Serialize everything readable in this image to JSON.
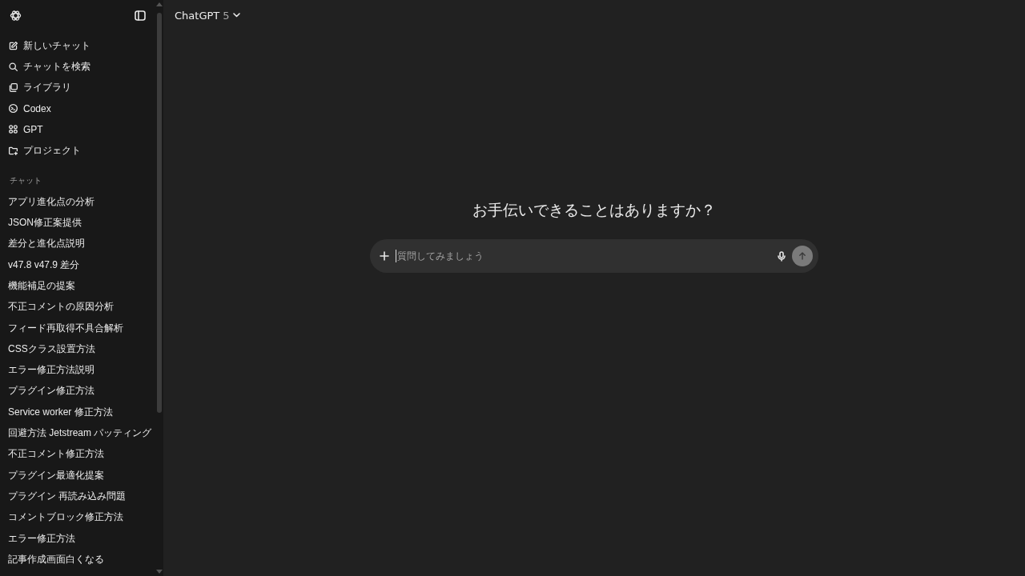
{
  "sidebar": {
    "nav_items": [
      {
        "kind": "new-chat",
        "label": "新しいチャット"
      },
      {
        "kind": "search",
        "label": "チャットを検索"
      },
      {
        "kind": "library",
        "label": "ライブラリ"
      },
      {
        "kind": "codex",
        "label": "Codex"
      },
      {
        "kind": "gpts",
        "label": "GPT"
      },
      {
        "kind": "project",
        "label": "プロジェクト"
      }
    ],
    "section_title": "チャット",
    "chats": [
      "アプリ進化点の分析",
      "JSON修正案提供",
      "差分と進化点説明",
      "v47.8 v47.9 差分",
      "機能補足の提案",
      "不正コメントの原因分析",
      "フィード再取得不具合解析",
      "CSSクラス設置方法",
      "エラー修正方法説明",
      "プラグイン修正方法",
      "Service worker 修正方法",
      "回避方法 Jetstream パッティング",
      "不正コメント修正方法",
      "プラグイン最適化提案",
      "プラグイン 再読み込み問題",
      "コメントブロック修正方法",
      "エラー修正方法",
      "記事作成画面白くなる"
    ]
  },
  "header": {
    "model_name": "ChatGPT",
    "model_version": "5"
  },
  "main": {
    "heading": "お手伝いできることはありますか？",
    "composer": {
      "placeholder": "質問してみましょう",
      "send_disabled": true
    }
  }
}
